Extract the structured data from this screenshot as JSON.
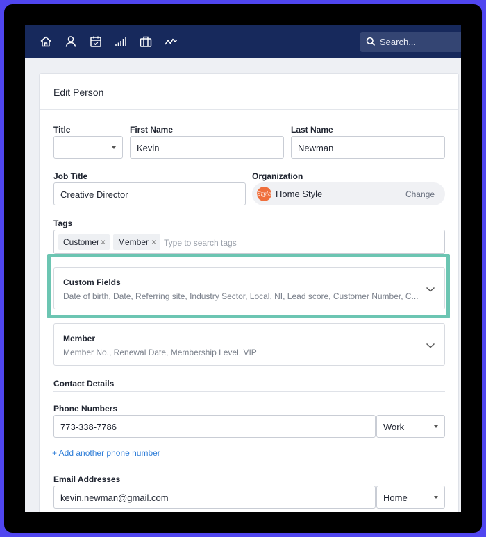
{
  "nav": {
    "icons": [
      "home-icon",
      "person-icon",
      "calendar-icon",
      "bar-chart-icon",
      "briefcase-icon",
      "activity-icon"
    ],
    "search_placeholder": "Search..."
  },
  "card": {
    "title": "Edit Person"
  },
  "form": {
    "title_label": "Title",
    "title_value": "",
    "first_name_label": "First Name",
    "first_name_value": "Kevin",
    "last_name_label": "Last Name",
    "last_name_value": "Newman",
    "job_title_label": "Job Title",
    "job_title_value": "Creative Director",
    "organization_label": "Organization",
    "organization_name": "Home Style",
    "organization_logo_text": "Style",
    "organization_change": "Change",
    "tags_label": "Tags",
    "tags": [
      {
        "label": "Customer",
        "remove": "×"
      },
      {
        "label": "Member",
        "remove": "×"
      }
    ],
    "tags_placeholder": "Type to search tags"
  },
  "panels": {
    "custom_fields": {
      "title": "Custom Fields",
      "summary": "Date of birth, Date, Referring site, Industry Sector, Local, NI, Lead score, Customer Number, C..."
    },
    "member": {
      "title": "Member",
      "summary": "Member No., Renewal Date, Membership Level, VIP"
    }
  },
  "contact": {
    "section_title": "Contact Details",
    "phone_label": "Phone Numbers",
    "phone_value": "773-338-7786",
    "phone_type": "Work",
    "add_phone": "+ Add another phone number",
    "email_label": "Email Addresses",
    "email_value": "kevin.newman@gmail.com",
    "email_type": "Home"
  },
  "colors": {
    "topbar": "#17295c",
    "highlight": "#6cc5b2",
    "link": "#2f7ed8",
    "org_logo": "#ef6f3c",
    "backdrop": "#5046f0"
  }
}
